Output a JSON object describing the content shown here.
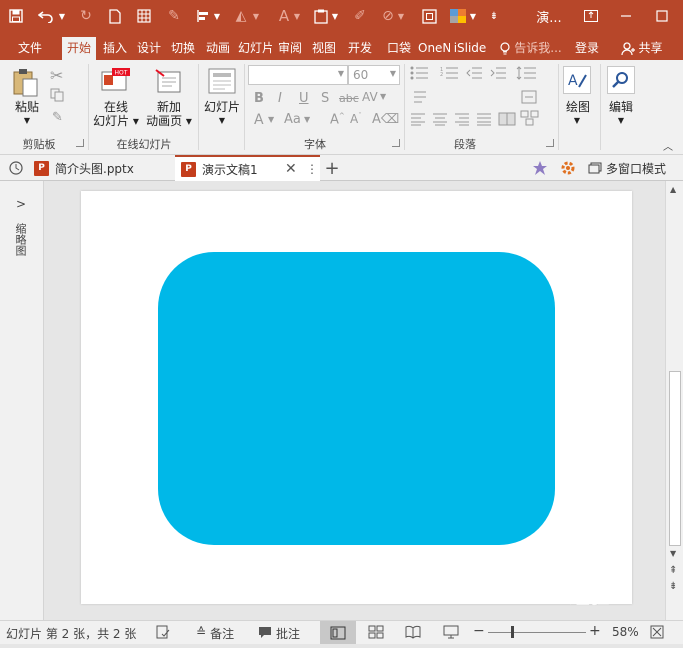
{
  "titlebar": {
    "title": "演..."
  },
  "tabs": [
    "文件",
    "开始",
    "插入",
    "设计",
    "切换",
    "动画",
    "幻灯片",
    "审阅",
    "视图",
    "开发",
    "口袋",
    "OneNote",
    "iSlide"
  ],
  "tell_me": "告诉我...",
  "login": "登录",
  "share": "共享",
  "ribbon": {
    "clipboard": {
      "paste": "粘贴",
      "group": "剪贴板"
    },
    "online": {
      "online_slide_1": "在线",
      "online_slide_2": "幻灯片",
      "new_anim_1": "新加",
      "new_anim_2": "动画页",
      "hot": "HOT",
      "group": "在线幻灯片"
    },
    "slides": {
      "label": "幻灯片"
    },
    "font": {
      "font_name": "",
      "font_size": "60",
      "group": "字体"
    },
    "paragraph": {
      "group": "段落"
    },
    "drawing": {
      "label": "绘图"
    },
    "editing": {
      "label": "编辑"
    }
  },
  "doc_tabs": {
    "tab1": "简介头图.pptx",
    "tab2": "演示文稿1",
    "multi_window": "多窗口模式"
  },
  "left_panel": {
    "thumbnails": "缩略图"
  },
  "status": {
    "slide_info": "幻灯片 第 2 张，共 2 张",
    "notes": "备注",
    "comments": "批注",
    "zoom": "58%"
  },
  "watermark": "Bai 经验",
  "colors": {
    "brand": "#b7472a",
    "shape_fill": "#00b8e8"
  }
}
